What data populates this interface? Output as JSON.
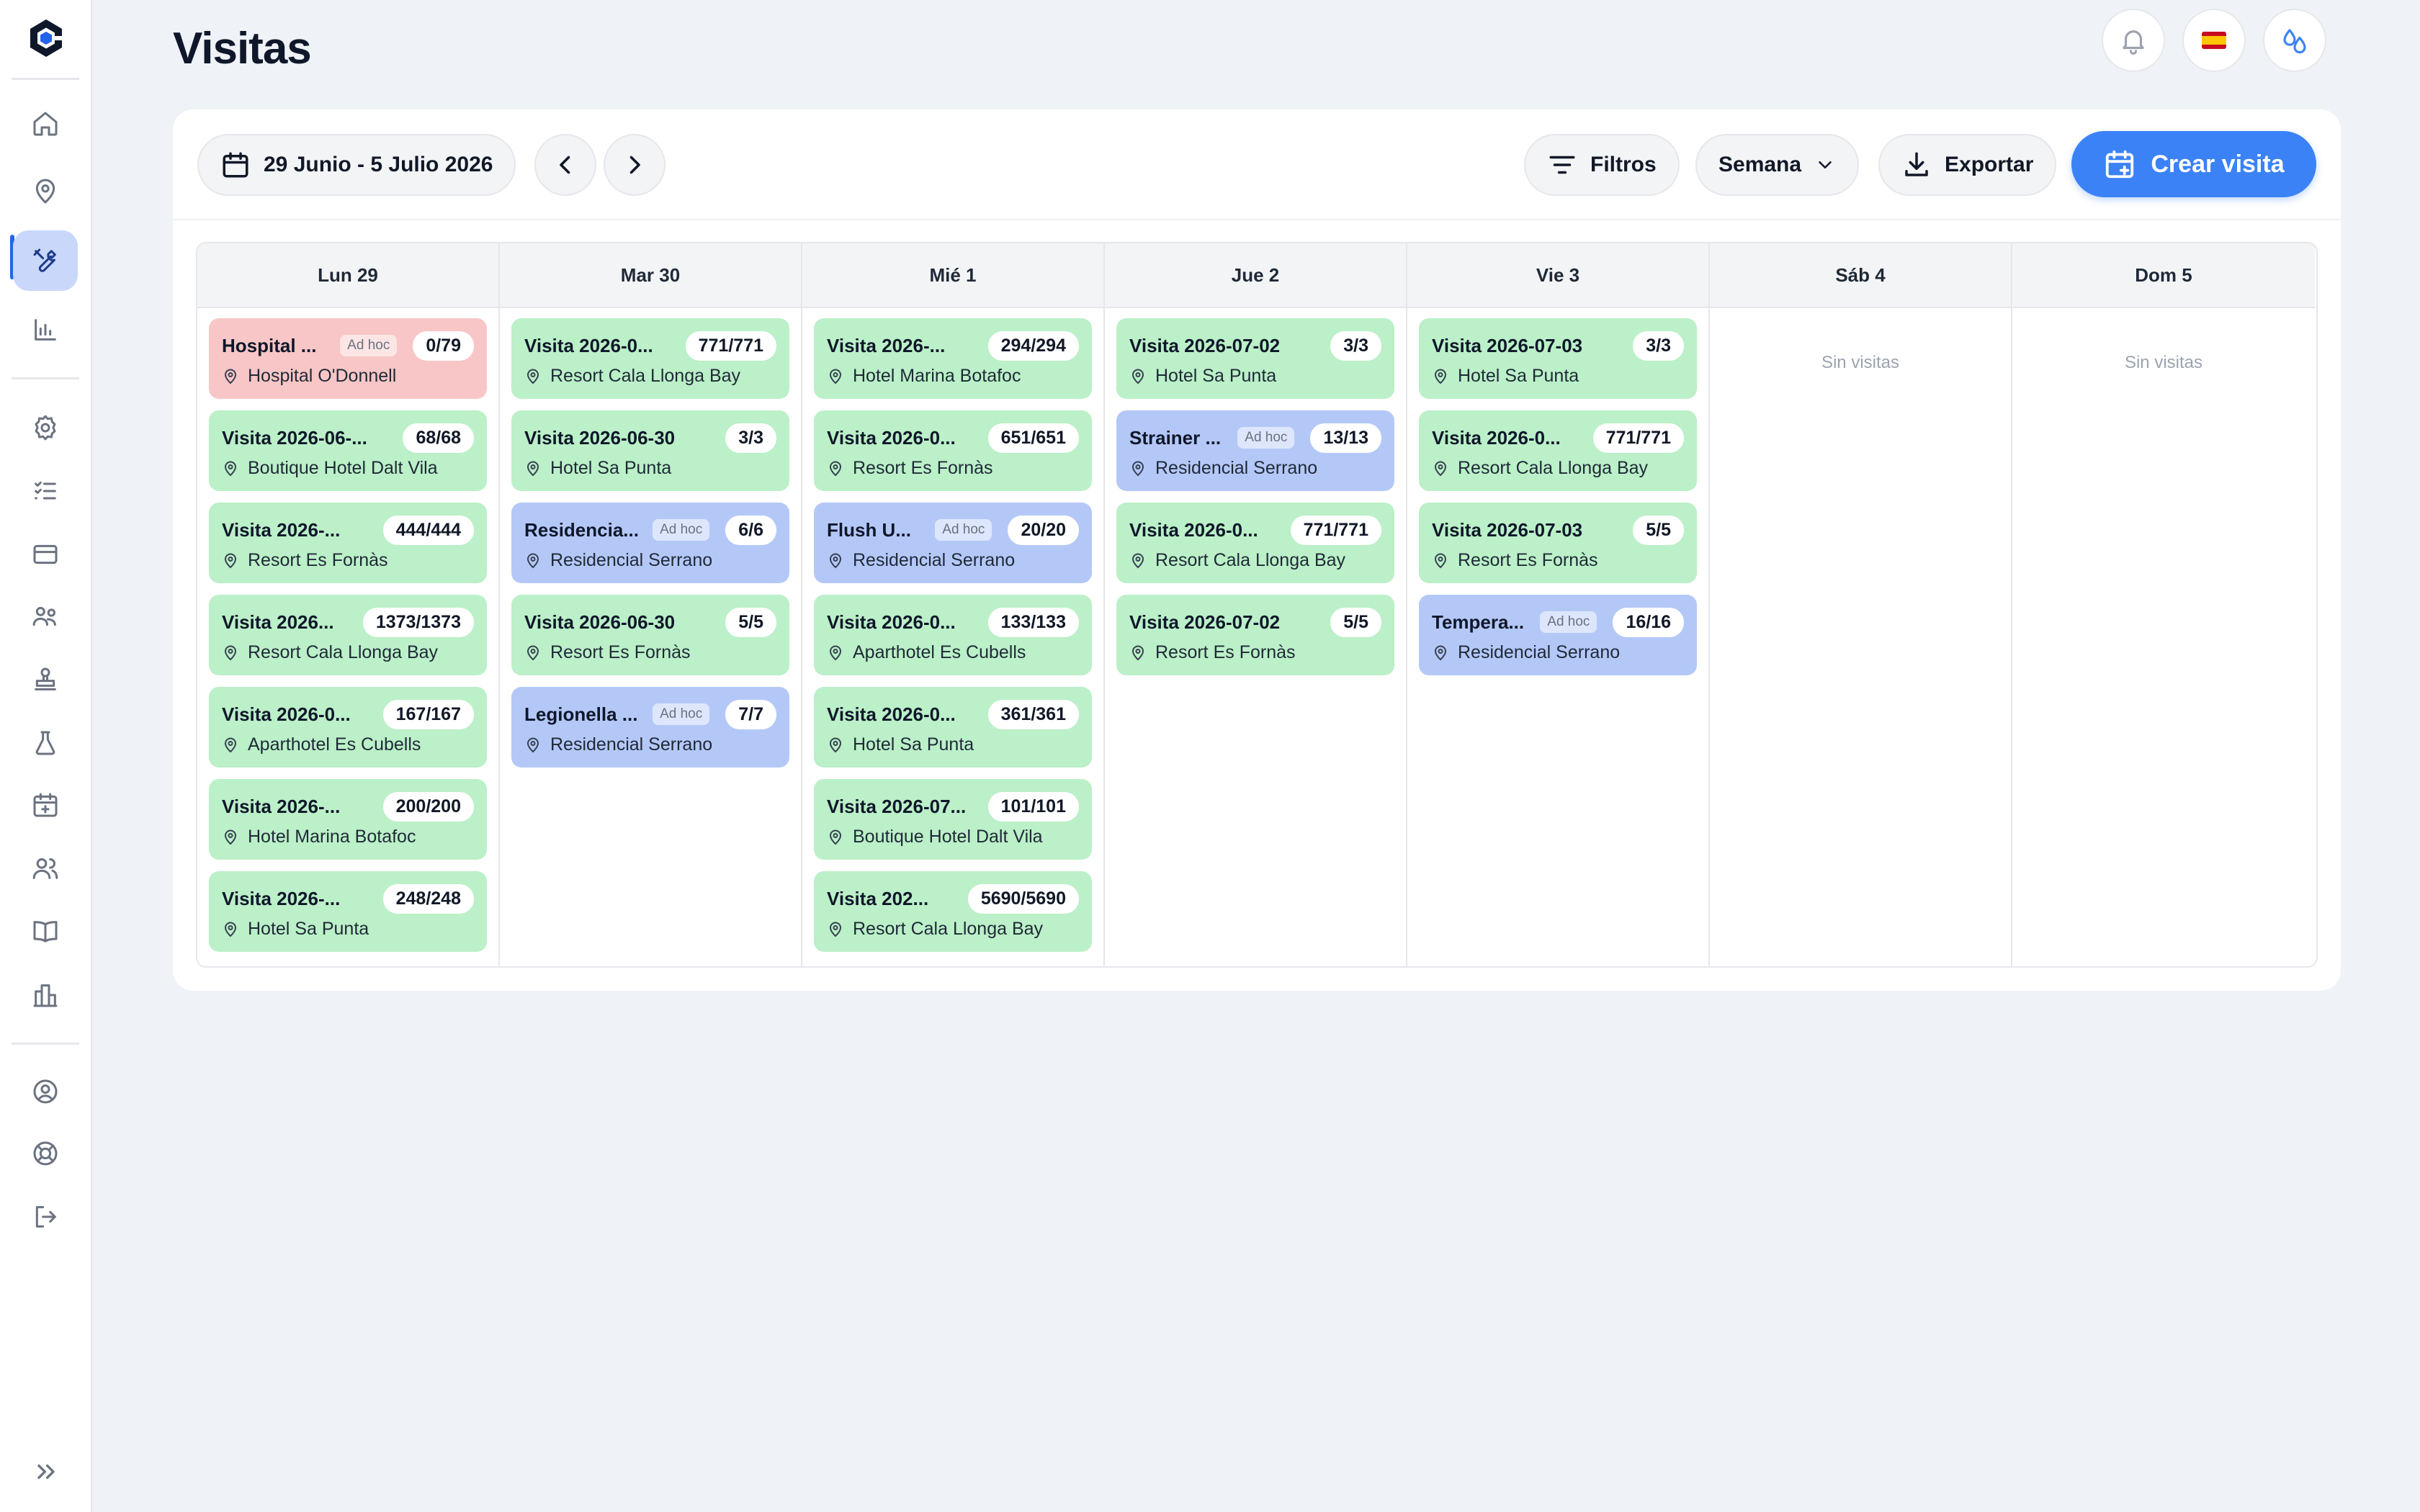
{
  "page": {
    "title": "Visitas"
  },
  "sidebar": {
    "logo": "app-logo",
    "items": [
      {
        "name": "home",
        "icon": "home-icon",
        "active": false
      },
      {
        "name": "locations",
        "icon": "map-pin-icon",
        "active": false
      },
      {
        "name": "visits",
        "icon": "tools-icon",
        "active": true
      },
      {
        "name": "analytics",
        "icon": "bar-chart-icon",
        "active": false
      },
      {
        "name": "settings",
        "icon": "gear-icon",
        "active": false
      },
      {
        "name": "tasks",
        "icon": "list-checks-icon",
        "active": false
      },
      {
        "name": "billing",
        "icon": "credit-card-icon",
        "active": false
      },
      {
        "name": "teams",
        "icon": "team-icon",
        "active": false
      },
      {
        "name": "stamp",
        "icon": "stamp-icon",
        "active": false
      },
      {
        "name": "lab",
        "icon": "flask-icon",
        "active": false
      },
      {
        "name": "calendar",
        "icon": "calendar-plus-icon",
        "active": false
      },
      {
        "name": "users",
        "icon": "users-icon",
        "active": false
      },
      {
        "name": "docs",
        "icon": "book-icon",
        "active": false
      },
      {
        "name": "buildings",
        "icon": "building-icon",
        "active": false
      },
      {
        "name": "profile",
        "icon": "user-circle-icon",
        "active": false
      },
      {
        "name": "support",
        "icon": "lifebuoy-icon",
        "active": false
      },
      {
        "name": "logout",
        "icon": "logout-icon",
        "active": false
      }
    ],
    "expand_icon": "chevrons-right-icon"
  },
  "topbar": {
    "notifications_icon": "bell-icon",
    "language": "es",
    "theme_icon": "water-drops-icon"
  },
  "toolbar": {
    "date_range": "29 Junio - 5 Julio 2026",
    "filters_label": "Filtros",
    "view_label": "Semana",
    "export_label": "Exportar",
    "create_label": "Crear visita"
  },
  "colors": {
    "accent": "#3b82f6",
    "visit_green": "#bbf0c8",
    "visit_blue": "#b4c8f8",
    "visit_red": "#f8c6c6"
  },
  "calendar": {
    "empty_label": "Sin visitas",
    "adhoc_label": "Ad hoc",
    "days": [
      {
        "label": "Lun 29",
        "visits": [
          {
            "title": "Hospital ...",
            "adhoc": true,
            "count": "0/79",
            "location": "Hospital O'Donnell",
            "color": "red"
          },
          {
            "title": "Visita 2026-06-...",
            "adhoc": false,
            "count": "68/68",
            "location": "Boutique Hotel Dalt Vila",
            "color": "green"
          },
          {
            "title": "Visita 2026-...",
            "adhoc": false,
            "count": "444/444",
            "location": "Resort Es Fornàs",
            "color": "green"
          },
          {
            "title": "Visita 2026...",
            "adhoc": false,
            "count": "1373/1373",
            "location": "Resort Cala Llonga Bay",
            "color": "green"
          },
          {
            "title": "Visita 2026-0...",
            "adhoc": false,
            "count": "167/167",
            "location": "Aparthotel Es Cubells",
            "color": "green"
          },
          {
            "title": "Visita 2026-...",
            "adhoc": false,
            "count": "200/200",
            "location": "Hotel Marina Botafoc",
            "color": "green"
          },
          {
            "title": "Visita 2026-...",
            "adhoc": false,
            "count": "248/248",
            "location": "Hotel Sa Punta",
            "color": "green"
          }
        ]
      },
      {
        "label": "Mar 30",
        "visits": [
          {
            "title": "Visita 2026-0...",
            "adhoc": false,
            "count": "771/771",
            "location": "Resort Cala Llonga Bay",
            "color": "green"
          },
          {
            "title": "Visita 2026-06-30",
            "adhoc": false,
            "count": "3/3",
            "location": "Hotel Sa Punta",
            "color": "green"
          },
          {
            "title": "Residencia...",
            "adhoc": true,
            "count": "6/6",
            "location": "Residencial Serrano",
            "color": "blue"
          },
          {
            "title": "Visita 2026-06-30",
            "adhoc": false,
            "count": "5/5",
            "location": "Resort Es Fornàs",
            "color": "green"
          },
          {
            "title": "Legionella ...",
            "adhoc": true,
            "count": "7/7",
            "location": "Residencial Serrano",
            "color": "blue"
          }
        ]
      },
      {
        "label": "Mié 1",
        "visits": [
          {
            "title": "Visita 2026-...",
            "adhoc": false,
            "count": "294/294",
            "location": "Hotel Marina Botafoc",
            "color": "green"
          },
          {
            "title": "Visita 2026-0...",
            "adhoc": false,
            "count": "651/651",
            "location": "Resort Es Fornàs",
            "color": "green"
          },
          {
            "title": "Flush U...",
            "adhoc": true,
            "count": "20/20",
            "location": "Residencial Serrano",
            "color": "blue"
          },
          {
            "title": "Visita 2026-0...",
            "adhoc": false,
            "count": "133/133",
            "location": "Aparthotel Es Cubells",
            "color": "green"
          },
          {
            "title": "Visita 2026-0...",
            "adhoc": false,
            "count": "361/361",
            "location": "Hotel Sa Punta",
            "color": "green"
          },
          {
            "title": "Visita 2026-07...",
            "adhoc": false,
            "count": "101/101",
            "location": "Boutique Hotel Dalt Vila",
            "color": "green"
          },
          {
            "title": "Visita 202...",
            "adhoc": false,
            "count": "5690/5690",
            "location": "Resort Cala Llonga Bay",
            "color": "green"
          }
        ]
      },
      {
        "label": "Jue 2",
        "visits": [
          {
            "title": "Visita 2026-07-02",
            "adhoc": false,
            "count": "3/3",
            "location": "Hotel Sa Punta",
            "color": "green"
          },
          {
            "title": "Strainer ...",
            "adhoc": true,
            "count": "13/13",
            "location": "Residencial Serrano",
            "color": "blue"
          },
          {
            "title": "Visita 2026-0...",
            "adhoc": false,
            "count": "771/771",
            "location": "Resort Cala Llonga Bay",
            "color": "green"
          },
          {
            "title": "Visita 2026-07-02",
            "adhoc": false,
            "count": "5/5",
            "location": "Resort Es Fornàs",
            "color": "green"
          }
        ]
      },
      {
        "label": "Vie 3",
        "visits": [
          {
            "title": "Visita 2026-07-03",
            "adhoc": false,
            "count": "3/3",
            "location": "Hotel Sa Punta",
            "color": "green"
          },
          {
            "title": "Visita 2026-0...",
            "adhoc": false,
            "count": "771/771",
            "location": "Resort Cala Llonga Bay",
            "color": "green"
          },
          {
            "title": "Visita 2026-07-03",
            "adhoc": false,
            "count": "5/5",
            "location": "Resort Es Fornàs",
            "color": "green"
          },
          {
            "title": "Tempera...",
            "adhoc": true,
            "count": "16/16",
            "location": "Residencial Serrano",
            "color": "blue"
          }
        ]
      },
      {
        "label": "Sáb 4",
        "visits": []
      },
      {
        "label": "Dom 5",
        "visits": []
      }
    ]
  }
}
